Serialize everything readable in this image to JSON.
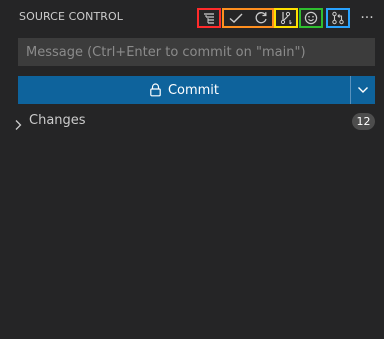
{
  "header": {
    "title": "SOURCE CONTROL",
    "toolbar": [
      {
        "name": "view-as-tree",
        "icon": "list-tree-icon",
        "outline": "#ff2b2b"
      },
      {
        "name": "commit",
        "icon": "check-icon",
        "outline": "#ff8f1f"
      },
      {
        "name": "refresh",
        "icon": "refresh-icon",
        "outline": "#ff8f1f"
      },
      {
        "name": "branch",
        "icon": "branch-icon",
        "outline": "#ffe100"
      },
      {
        "name": "smiley",
        "icon": "smiley-icon",
        "outline": "#2fbf2f"
      },
      {
        "name": "pull-request",
        "icon": "pull-request-icon",
        "outline": "#29a3ff"
      }
    ],
    "more_label": "···"
  },
  "message": {
    "placeholder": "Message (Ctrl+Enter to commit on \"main\")",
    "value": ""
  },
  "commit_button": {
    "label": "Commit",
    "icon": "lock-icon",
    "dropdown_icon": "chevron-down-icon",
    "color": "#0e639c"
  },
  "changes": {
    "label": "Changes",
    "count": "12",
    "icon": "chevron-right-icon"
  }
}
